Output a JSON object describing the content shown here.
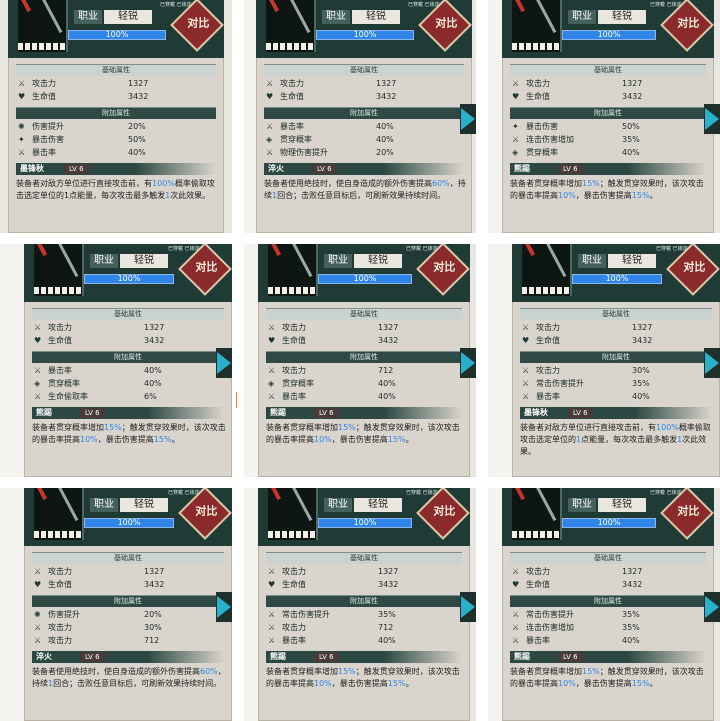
{
  "common": {
    "profession_label": "职业",
    "profession_value": "轻锐",
    "progress_text": "100%",
    "progress_fraction": 1.0,
    "compare_button": "对比",
    "section_base": "基础属性",
    "section_extra": "附加属性",
    "tag_equipped": "已穿戴",
    "tag_locked": "已锁定",
    "atk_label": "攻击力",
    "atk_value": "1327",
    "hp_label": "生命值",
    "hp_value": "3432",
    "colors": {
      "header": "#203a36",
      "accent": "#2f86e8",
      "compare": "#8a2a2a",
      "arrow": "#2ab0c9"
    }
  },
  "panels": [
    {
      "extra": [
        {
          "icon": "gear-icon",
          "label": "伤害提升",
          "value": "20%"
        },
        {
          "icon": "burst-icon",
          "label": "暴击伤害",
          "value": "50%"
        },
        {
          "icon": "sword-icon",
          "label": "暴击率",
          "value": "40%"
        }
      ],
      "skill_name": "墨锋秋",
      "skill_level": "LV 6",
      "desc": [
        {
          "t": "装备者对敌方单位进行直接攻击前，有"
        },
        {
          "t": "10",
          "h": true
        },
        {
          "t": "0%",
          "h": true
        },
        {
          "t": "概率偷取攻击选定单位的1点能量，每次攻击最多触发"
        },
        {
          "t": "1",
          "h": true
        },
        {
          "t": "次此效果。"
        }
      ]
    },
    {
      "extra": [
        {
          "icon": "sword-icon",
          "label": "暴击率",
          "value": "40%"
        },
        {
          "icon": "shield-icon",
          "label": "贯穿概率",
          "value": "40%"
        },
        {
          "icon": "sword-icon",
          "label": "物理伤害提升",
          "value": "20%"
        }
      ],
      "skill_name": "淬火",
      "skill_level": "LV 6",
      "desc": [
        {
          "t": "装备者使用绝技时，使自身造成的额外伤害提高"
        },
        {
          "t": "60%",
          "h": true
        },
        {
          "t": "，持续"
        },
        {
          "t": "1",
          "h": true
        },
        {
          "t": "回合；击败任意目标后，可刷新效果持续时间。"
        }
      ]
    },
    {
      "extra": [
        {
          "icon": "burst-icon",
          "label": "暴击伤害",
          "value": "50%"
        },
        {
          "icon": "sword-icon",
          "label": "连击伤害增加",
          "value": "35%"
        },
        {
          "icon": "shield-icon",
          "label": "贯穿概率",
          "value": "40%"
        }
      ],
      "skill_name": "熊踢",
      "skill_level": "LV 6",
      "desc": [
        {
          "t": "装备者贯穿概率增加"
        },
        {
          "t": "15%",
          "h": true
        },
        {
          "t": "；触发贯穿效果时，该次攻击的暴击率提高"
        },
        {
          "t": "1",
          "h": true
        },
        {
          "t": "0%",
          "h": true
        },
        {
          "t": "，暴击伤害提高"
        },
        {
          "t": "15%",
          "h": true
        },
        {
          "t": "。"
        }
      ]
    },
    {
      "extra": [
        {
          "icon": "sword-icon",
          "label": "暴击率",
          "value": "40%"
        },
        {
          "icon": "shield-icon",
          "label": "贯穿概率",
          "value": "40%"
        },
        {
          "icon": "sword-icon",
          "label": "生命偷取率",
          "value": "6%"
        }
      ],
      "skill_name": "熊踢",
      "skill_level": "LV 6",
      "desc": [
        {
          "t": "装备者贯穿概率增加"
        },
        {
          "t": "15%",
          "h": true
        },
        {
          "t": "；触发贯穿效果时，该次攻击的暴击率提高"
        },
        {
          "t": "10%",
          "h": true
        },
        {
          "t": "，暴击伤害提高"
        },
        {
          "t": "15%",
          "h": true
        },
        {
          "t": "。"
        }
      ]
    },
    {
      "extra": [
        {
          "icon": "sword-icon",
          "label": "攻击力",
          "value": "712"
        },
        {
          "icon": "shield-icon",
          "label": "贯穿概率",
          "value": "40%"
        },
        {
          "icon": "sword-icon",
          "label": "暴击率",
          "value": "40%"
        }
      ],
      "skill_name": "熊踢",
      "skill_level": "LV 6",
      "desc": [
        {
          "t": "装备者贯穿概率增加"
        },
        {
          "t": "15%",
          "h": true
        },
        {
          "t": "；触发贯穿效果时，该次攻击的暴击率提高"
        },
        {
          "t": "1",
          "h": true
        },
        {
          "t": "0%",
          "h": true
        },
        {
          "t": "，暴击伤害提高"
        },
        {
          "t": "15%",
          "h": true
        },
        {
          "t": "。"
        }
      ]
    },
    {
      "extra": [
        {
          "icon": "sword-icon",
          "label": "攻击力",
          "value": "30%"
        },
        {
          "icon": "sword-icon",
          "label": "常击伤害提升",
          "value": "35%"
        },
        {
          "icon": "sword-icon",
          "label": "暴击率",
          "value": "40%"
        }
      ],
      "skill_name": "墨锋秋",
      "skill_level": "LV 6",
      "desc": [
        {
          "t": "装备者对敌方单位进行直接攻击前，有"
        },
        {
          "t": "10",
          "h": true
        },
        {
          "t": "0%",
          "h": true
        },
        {
          "t": "概率偷取攻击选定单位的"
        },
        {
          "t": "1",
          "h": true
        },
        {
          "t": "点能量，每次攻击最多触发"
        },
        {
          "t": "1",
          "h": true
        },
        {
          "t": "次此效果。"
        }
      ]
    },
    {
      "extra": [
        {
          "icon": "gear-icon",
          "label": "伤害提升",
          "value": "20%"
        },
        {
          "icon": "sword-icon",
          "label": "攻击力",
          "value": "30%"
        },
        {
          "icon": "sword-icon",
          "label": "攻击力",
          "value": "712"
        }
      ],
      "skill_name": "淬火",
      "skill_level": "LV 6",
      "desc": [
        {
          "t": "装备者使用绝技时，使自身造成的额外伤害提高"
        },
        {
          "t": "60%",
          "h": true
        },
        {
          "t": "，持续"
        },
        {
          "t": "1",
          "h": true
        },
        {
          "t": "回合；击败任意目标后，可刷新效果持续时间。"
        }
      ]
    },
    {
      "extra": [
        {
          "icon": "sword-icon",
          "label": "常击伤害提升",
          "value": "35%"
        },
        {
          "icon": "sword-icon",
          "label": "攻击力",
          "value": "712"
        },
        {
          "icon": "sword-icon",
          "label": "暴击率",
          "value": "40%"
        }
      ],
      "skill_name": "熊踢",
      "skill_level": "LV 6",
      "desc": [
        {
          "t": "装备者贯穿概率增加"
        },
        {
          "t": "15%",
          "h": true
        },
        {
          "t": "；触发贯穿效果时，该次攻击的暴击率提高"
        },
        {
          "t": "1",
          "h": true
        },
        {
          "t": "0%",
          "h": true
        },
        {
          "t": "，暴击伤害提高"
        },
        {
          "t": "15%",
          "h": true
        },
        {
          "t": "。"
        }
      ]
    },
    {
      "extra": [
        {
          "icon": "sword-icon",
          "label": "常击伤害提升",
          "value": "35%"
        },
        {
          "icon": "sword-icon",
          "label": "连击伤害增加",
          "value": "35%"
        },
        {
          "icon": "sword-icon",
          "label": "暴击率",
          "value": "40%"
        }
      ],
      "skill_name": "熊踢",
      "skill_level": "LV 6",
      "desc": [
        {
          "t": "装备者贯穿概率增加"
        },
        {
          "t": "15%",
          "h": true
        },
        {
          "t": "；触发贯穿效果时，该次攻击的暴击率提高"
        },
        {
          "t": "1",
          "h": true
        },
        {
          "t": "0%",
          "h": true
        },
        {
          "t": "，暴击伤害提高"
        },
        {
          "t": "15%",
          "h": true
        },
        {
          "t": "。"
        }
      ]
    }
  ]
}
